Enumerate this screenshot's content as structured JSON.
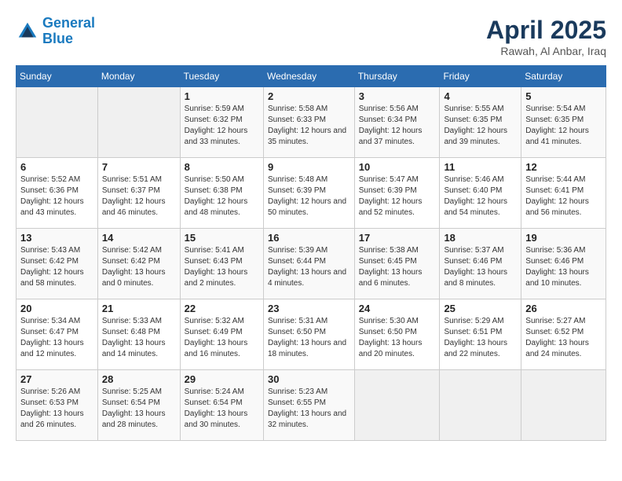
{
  "header": {
    "logo_line1": "General",
    "logo_line2": "Blue",
    "title": "April 2025",
    "subtitle": "Rawah, Al Anbar, Iraq"
  },
  "days_of_week": [
    "Sunday",
    "Monday",
    "Tuesday",
    "Wednesday",
    "Thursday",
    "Friday",
    "Saturday"
  ],
  "weeks": [
    [
      {
        "day": "",
        "info": ""
      },
      {
        "day": "",
        "info": ""
      },
      {
        "day": "1",
        "info": "Sunrise: 5:59 AM\nSunset: 6:32 PM\nDaylight: 12 hours and 33 minutes."
      },
      {
        "day": "2",
        "info": "Sunrise: 5:58 AM\nSunset: 6:33 PM\nDaylight: 12 hours and 35 minutes."
      },
      {
        "day": "3",
        "info": "Sunrise: 5:56 AM\nSunset: 6:34 PM\nDaylight: 12 hours and 37 minutes."
      },
      {
        "day": "4",
        "info": "Sunrise: 5:55 AM\nSunset: 6:35 PM\nDaylight: 12 hours and 39 minutes."
      },
      {
        "day": "5",
        "info": "Sunrise: 5:54 AM\nSunset: 6:35 PM\nDaylight: 12 hours and 41 minutes."
      }
    ],
    [
      {
        "day": "6",
        "info": "Sunrise: 5:52 AM\nSunset: 6:36 PM\nDaylight: 12 hours and 43 minutes."
      },
      {
        "day": "7",
        "info": "Sunrise: 5:51 AM\nSunset: 6:37 PM\nDaylight: 12 hours and 46 minutes."
      },
      {
        "day": "8",
        "info": "Sunrise: 5:50 AM\nSunset: 6:38 PM\nDaylight: 12 hours and 48 minutes."
      },
      {
        "day": "9",
        "info": "Sunrise: 5:48 AM\nSunset: 6:39 PM\nDaylight: 12 hours and 50 minutes."
      },
      {
        "day": "10",
        "info": "Sunrise: 5:47 AM\nSunset: 6:39 PM\nDaylight: 12 hours and 52 minutes."
      },
      {
        "day": "11",
        "info": "Sunrise: 5:46 AM\nSunset: 6:40 PM\nDaylight: 12 hours and 54 minutes."
      },
      {
        "day": "12",
        "info": "Sunrise: 5:44 AM\nSunset: 6:41 PM\nDaylight: 12 hours and 56 minutes."
      }
    ],
    [
      {
        "day": "13",
        "info": "Sunrise: 5:43 AM\nSunset: 6:42 PM\nDaylight: 12 hours and 58 minutes."
      },
      {
        "day": "14",
        "info": "Sunrise: 5:42 AM\nSunset: 6:42 PM\nDaylight: 13 hours and 0 minutes."
      },
      {
        "day": "15",
        "info": "Sunrise: 5:41 AM\nSunset: 6:43 PM\nDaylight: 13 hours and 2 minutes."
      },
      {
        "day": "16",
        "info": "Sunrise: 5:39 AM\nSunset: 6:44 PM\nDaylight: 13 hours and 4 minutes."
      },
      {
        "day": "17",
        "info": "Sunrise: 5:38 AM\nSunset: 6:45 PM\nDaylight: 13 hours and 6 minutes."
      },
      {
        "day": "18",
        "info": "Sunrise: 5:37 AM\nSunset: 6:46 PM\nDaylight: 13 hours and 8 minutes."
      },
      {
        "day": "19",
        "info": "Sunrise: 5:36 AM\nSunset: 6:46 PM\nDaylight: 13 hours and 10 minutes."
      }
    ],
    [
      {
        "day": "20",
        "info": "Sunrise: 5:34 AM\nSunset: 6:47 PM\nDaylight: 13 hours and 12 minutes."
      },
      {
        "day": "21",
        "info": "Sunrise: 5:33 AM\nSunset: 6:48 PM\nDaylight: 13 hours and 14 minutes."
      },
      {
        "day": "22",
        "info": "Sunrise: 5:32 AM\nSunset: 6:49 PM\nDaylight: 13 hours and 16 minutes."
      },
      {
        "day": "23",
        "info": "Sunrise: 5:31 AM\nSunset: 6:50 PM\nDaylight: 13 hours and 18 minutes."
      },
      {
        "day": "24",
        "info": "Sunrise: 5:30 AM\nSunset: 6:50 PM\nDaylight: 13 hours and 20 minutes."
      },
      {
        "day": "25",
        "info": "Sunrise: 5:29 AM\nSunset: 6:51 PM\nDaylight: 13 hours and 22 minutes."
      },
      {
        "day": "26",
        "info": "Sunrise: 5:27 AM\nSunset: 6:52 PM\nDaylight: 13 hours and 24 minutes."
      }
    ],
    [
      {
        "day": "27",
        "info": "Sunrise: 5:26 AM\nSunset: 6:53 PM\nDaylight: 13 hours and 26 minutes."
      },
      {
        "day": "28",
        "info": "Sunrise: 5:25 AM\nSunset: 6:54 PM\nDaylight: 13 hours and 28 minutes."
      },
      {
        "day": "29",
        "info": "Sunrise: 5:24 AM\nSunset: 6:54 PM\nDaylight: 13 hours and 30 minutes."
      },
      {
        "day": "30",
        "info": "Sunrise: 5:23 AM\nSunset: 6:55 PM\nDaylight: 13 hours and 32 minutes."
      },
      {
        "day": "",
        "info": ""
      },
      {
        "day": "",
        "info": ""
      },
      {
        "day": "",
        "info": ""
      }
    ]
  ]
}
